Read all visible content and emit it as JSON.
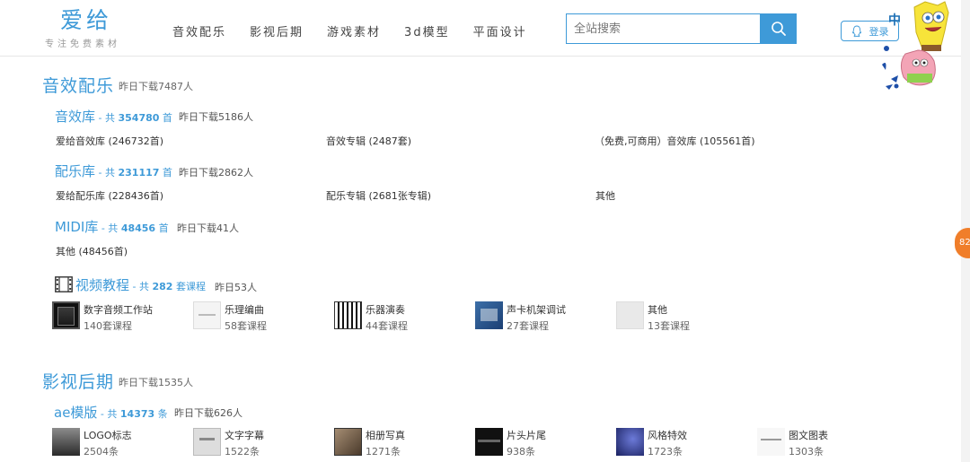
{
  "logo": {
    "title": "爱给",
    "tagline": "专注免费素材"
  },
  "nav": [
    "音效配乐",
    "影视后期",
    "游戏素材",
    "3d模型",
    "平面设计"
  ],
  "search": {
    "placeholder": "全站搜索",
    "value": ""
  },
  "login": {
    "label": "登录"
  },
  "lang": {
    "label": "中"
  },
  "side_badge": {
    "text": "82"
  },
  "audio": {
    "title": "音效配乐",
    "yesterday": "昨日下载7487人",
    "sfx": {
      "name": "音效库",
      "mid": " - 共 ",
      "count": "354780",
      "unit": " 首",
      "yesterday": "昨日下载5186人",
      "links": [
        "爱给音效库 (246732首)",
        "音效专辑 (2487套)",
        "（免费,可商用）音效库 (105561首)"
      ]
    },
    "music": {
      "name": "配乐库",
      "mid": " - 共 ",
      "count": "231117",
      "unit": " 首",
      "yesterday": "昨日下载2862人",
      "links": [
        "爱给配乐库 (228436首)",
        "配乐专辑 (2681张专辑)",
        "其他"
      ]
    },
    "midi": {
      "name": "MIDI库",
      "mid": " - 共 ",
      "count": "48456",
      "unit": " 首",
      "yesterday": "昨日下载41人",
      "links": [
        "其他 (48456首)"
      ]
    },
    "video": {
      "name": "视频教程",
      "mid": " - 共 ",
      "count": "282",
      "unit": " 套课程",
      "yesterday": "昨日53人",
      "tiles": [
        {
          "name": "数字音频工作站",
          "count": "140套课程"
        },
        {
          "name": "乐理编曲",
          "count": "58套课程"
        },
        {
          "name": "乐器演奏",
          "count": "44套课程"
        },
        {
          "name": "声卡机架调试",
          "count": "27套课程"
        },
        {
          "name": "其他",
          "count": "13套课程"
        }
      ]
    }
  },
  "film": {
    "title": "影视后期",
    "yesterday": "昨日下载1535人",
    "ae": {
      "name": "ae模版",
      "mid": " - 共 ",
      "count": "14373",
      "unit": " 条",
      "yesterday": "昨日下载626人",
      "tiles": [
        {
          "name": "LOGO标志",
          "count": "2504条"
        },
        {
          "name": "文字字幕",
          "count": "1522条"
        },
        {
          "name": "相册写真",
          "count": "1271条"
        },
        {
          "name": "片头片尾",
          "count": "938条"
        },
        {
          "name": "风格特效",
          "count": "1723条"
        },
        {
          "name": "图文图表",
          "count": "1303条"
        }
      ]
    }
  },
  "colors": {
    "accent": "#3e9ad8",
    "badge": "#f07e2a"
  }
}
